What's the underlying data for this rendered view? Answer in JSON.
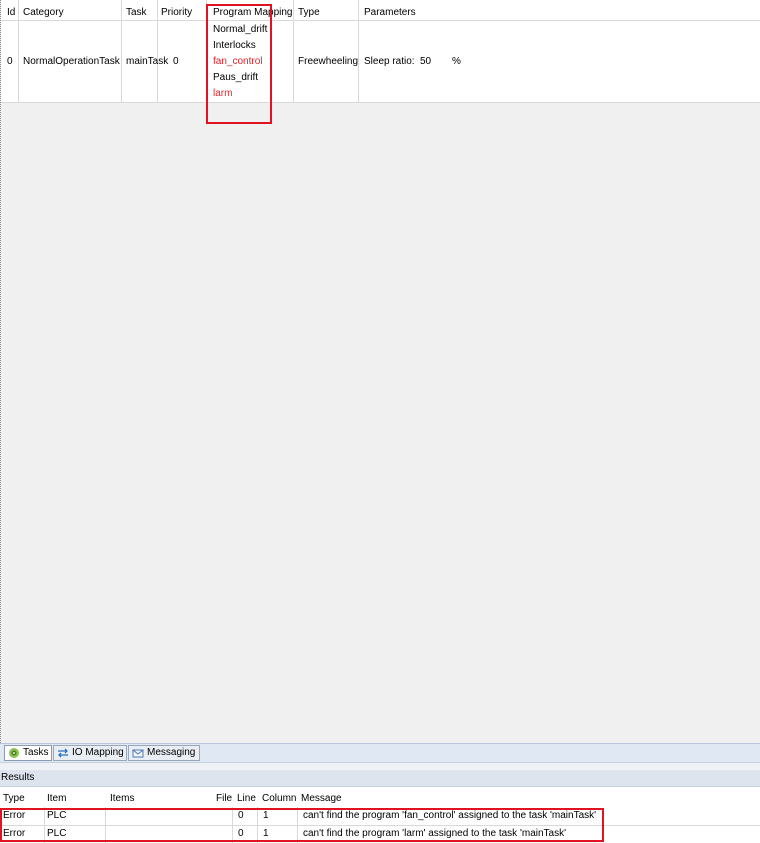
{
  "tasks_table": {
    "columns": [
      "Id",
      "Category",
      "Task",
      "Priority",
      "Program Mapping",
      "Type",
      "Parameters"
    ],
    "row": {
      "id": "0",
      "category": "NormalOperationTask",
      "task": "mainTask",
      "priority": "0",
      "programs": [
        {
          "name": "Normal_drift",
          "error": false
        },
        {
          "name": "Interlocks",
          "error": false
        },
        {
          "name": "fan_control",
          "error": true
        },
        {
          "name": "Paus_drift",
          "error": false
        },
        {
          "name": "larm",
          "error": true
        }
      ],
      "type": "Freewheeling",
      "param_label": "Sleep ratio:",
      "param_value": "50",
      "param_unit": "%"
    }
  },
  "tabs": [
    {
      "label": "Tasks",
      "icon": "tasks-gear-icon",
      "active": true
    },
    {
      "label": "IO Mapping",
      "icon": "io-mapping-icon",
      "active": false
    },
    {
      "label": "Messaging",
      "icon": "messaging-icon",
      "active": false
    }
  ],
  "results": {
    "title": "Results",
    "columns": [
      "Type",
      "Item",
      "Items",
      "File",
      "Line",
      "Column",
      "Message"
    ],
    "rows": [
      {
        "type": "Error",
        "item": "PLC",
        "items": "",
        "file": "",
        "line": "0",
        "column": "1",
        "message": "can't find the program 'fan_control' assigned to the task 'mainTask'"
      },
      {
        "type": "Error",
        "item": "PLC",
        "items": "",
        "file": "",
        "line": "0",
        "column": "1",
        "message": "can't find the program 'larm' assigned to the task 'mainTask'"
      }
    ]
  },
  "colors": {
    "error_text": "#e3222a",
    "highlight_box": "#e0141e",
    "tab_bar": "#dfe8f3"
  }
}
